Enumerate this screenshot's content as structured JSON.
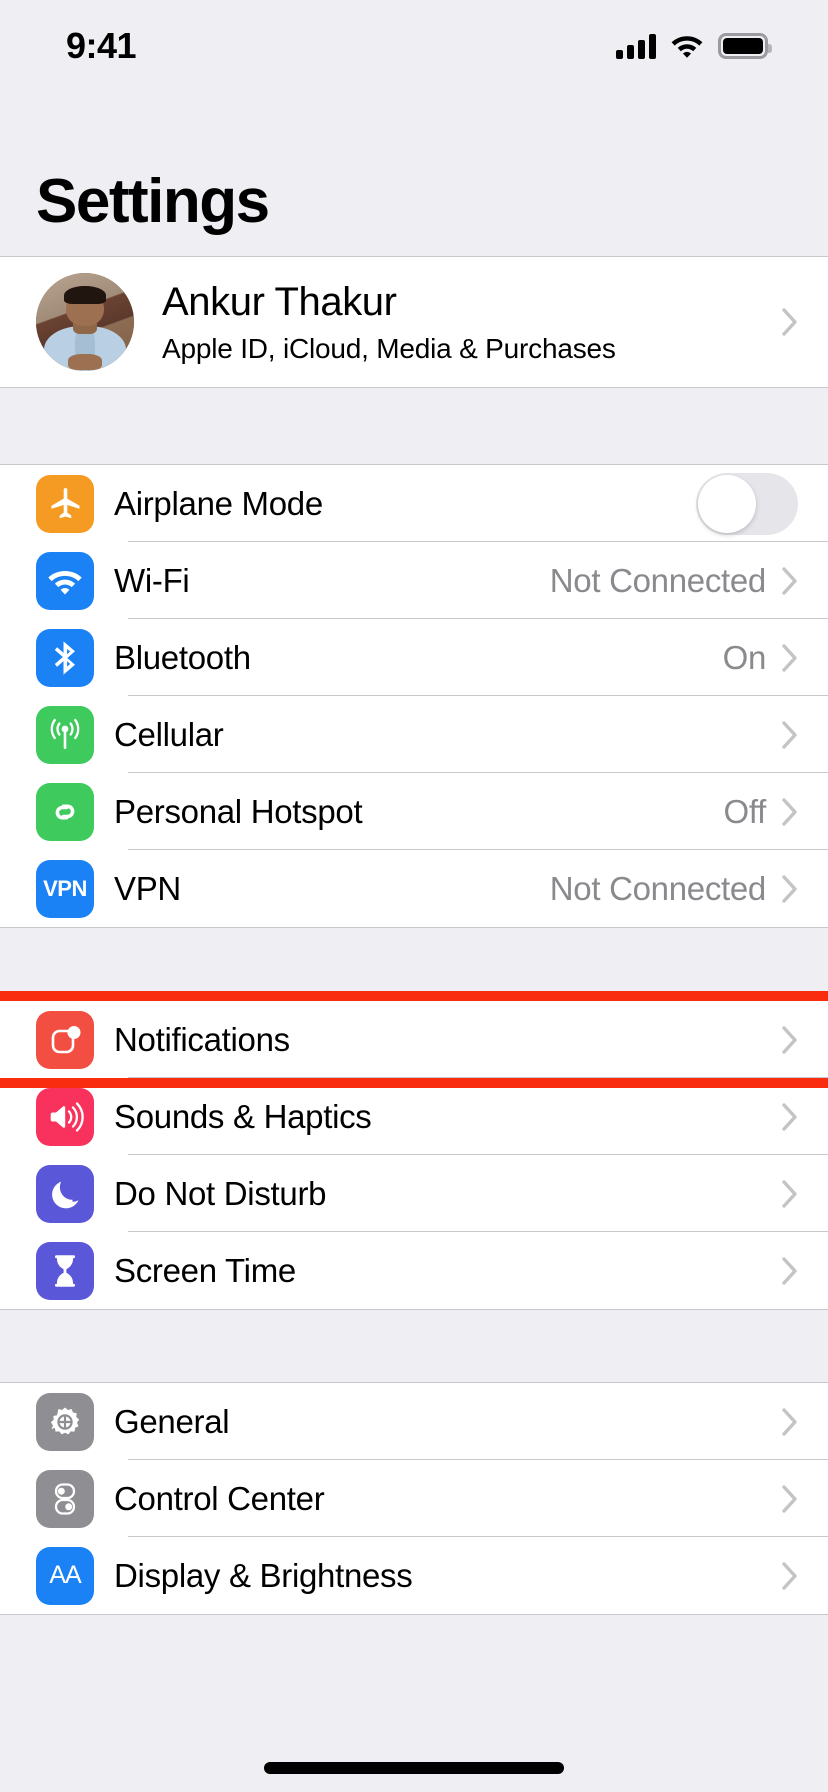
{
  "status_bar": {
    "time": "9:41",
    "signal_icon": "cellular-signal-icon",
    "wifi_icon": "wifi-icon",
    "battery_icon": "battery-full-icon"
  },
  "header": {
    "title": "Settings"
  },
  "profile": {
    "name": "Ankur Thakur",
    "subtitle": "Apple ID, iCloud, Media & Purchases",
    "avatar_name": "avatar",
    "chevron": "chevron-right-icon"
  },
  "highlight": {
    "color": "#F92C10",
    "target": "Notifications"
  },
  "groups": [
    {
      "id": "connectivity",
      "rows": [
        {
          "label": "Airplane Mode",
          "value": "",
          "icon": "airplane-icon",
          "icon_color": "#F59B23",
          "control": "toggle",
          "toggle_on": false
        },
        {
          "label": "Wi-Fi",
          "value": "Not Connected",
          "icon": "wifi-icon",
          "icon_color": "#1B82F6",
          "control": "chevron"
        },
        {
          "label": "Bluetooth",
          "value": "On",
          "icon": "bluetooth-icon",
          "icon_color": "#1B82F6",
          "control": "chevron"
        },
        {
          "label": "Cellular",
          "value": "",
          "icon": "cellular-antenna-icon",
          "icon_color": "#3ECA5C",
          "control": "chevron"
        },
        {
          "label": "Personal Hotspot",
          "value": "Off",
          "icon": "hotspot-link-icon",
          "icon_color": "#3ECA5C",
          "control": "chevron"
        },
        {
          "label": "VPN",
          "value": "Not Connected",
          "icon": "vpn-icon",
          "icon_color": "#1B82F6",
          "control": "chevron"
        }
      ]
    },
    {
      "id": "notifications",
      "rows": [
        {
          "label": "Notifications",
          "value": "",
          "icon": "notifications-icon",
          "icon_color": "#F24E41",
          "control": "chevron"
        },
        {
          "label": "Sounds & Haptics",
          "value": "",
          "icon": "speaker-icon",
          "icon_color": "#F8325C",
          "control": "chevron"
        },
        {
          "label": "Do Not Disturb",
          "value": "",
          "icon": "moon-icon",
          "icon_color": "#5A57D8",
          "control": "chevron"
        },
        {
          "label": "Screen Time",
          "value": "",
          "icon": "hourglass-icon",
          "icon_color": "#5A57D8",
          "control": "chevron"
        }
      ]
    },
    {
      "id": "system",
      "rows": [
        {
          "label": "General",
          "value": "",
          "icon": "gear-icon",
          "icon_color": "#8E8E93",
          "control": "chevron"
        },
        {
          "label": "Control Center",
          "value": "",
          "icon": "control-center-icon",
          "icon_color": "#8E8E93",
          "control": "chevron"
        },
        {
          "label": "Display & Brightness",
          "value": "",
          "icon": "text-size-icon",
          "icon_color": "#1B82F6",
          "control": "chevron"
        }
      ]
    }
  ]
}
